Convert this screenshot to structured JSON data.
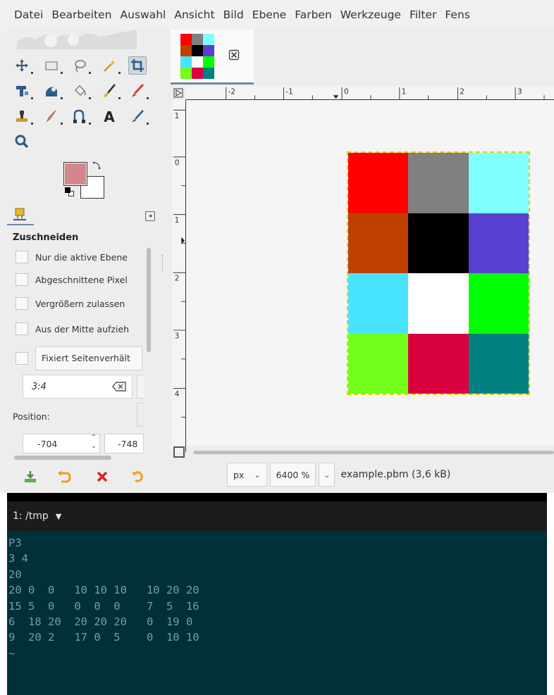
{
  "menubar": {
    "items": [
      "Datei",
      "Bearbeiten",
      "Auswahl",
      "Ansicht",
      "Bild",
      "Ebene",
      "Farben",
      "Werkzeuge",
      "Filter",
      "Fens"
    ]
  },
  "toolbox": {
    "colors": {
      "foreground": "#d4878a",
      "background": "#ffffff"
    },
    "tools": [
      "move-icon",
      "rect-select-icon",
      "lasso-icon",
      "fuzzy-select-icon",
      "crop-icon",
      "unified-transform-icon",
      "warp-icon",
      "paint-bucket-icon",
      "paintbrush-icon",
      "eraser-icon",
      "clone-icon",
      "smudge-icon",
      "paths-icon",
      "text-icon",
      "color-picker-icon",
      "zoom-icon"
    ]
  },
  "tool_options": {
    "title": "Zuschneiden",
    "options": [
      "Nur die aktive Ebene",
      "Abgeschnittene Pixel",
      "Vergrößern zulassen",
      "Aus der Mitte aufzieh"
    ],
    "fixed_label": "Fixiert  Seitenverhält",
    "ratio_value": "3:4",
    "position_label": "Position:",
    "position_x": "-704",
    "position_y": "-748"
  },
  "image_window": {
    "ruler_labels": [
      "-2",
      "-1",
      "0",
      "1",
      "2",
      "3"
    ],
    "vruler_labels": [
      "1",
      "0",
      "1",
      "2",
      "3",
      "4"
    ],
    "pixels": [
      [
        "#ff0000",
        "#808080",
        "#80ffff"
      ],
      [
        "#c04000",
        "#000000",
        "#5a40d0"
      ],
      [
        "#48e4ff",
        "#ffffff",
        "#00ff00"
      ],
      [
        "#72ff1a",
        "#d90040",
        "#008080"
      ]
    ],
    "unit": "px",
    "zoom": "6400 %",
    "file_info": "example.pbm (3,6 kB)"
  },
  "terminal": {
    "tab_label": "1: /tmp",
    "lines": [
      "P3",
      "3 4",
      "20",
      "20 0  0   10 10 10   10 20 20",
      "15 5  0   0  0  0    7  5  16",
      "6  18 20  20 20 20   0  19 0",
      "9  20 2   17 0  5    0  10 10",
      "~"
    ]
  }
}
